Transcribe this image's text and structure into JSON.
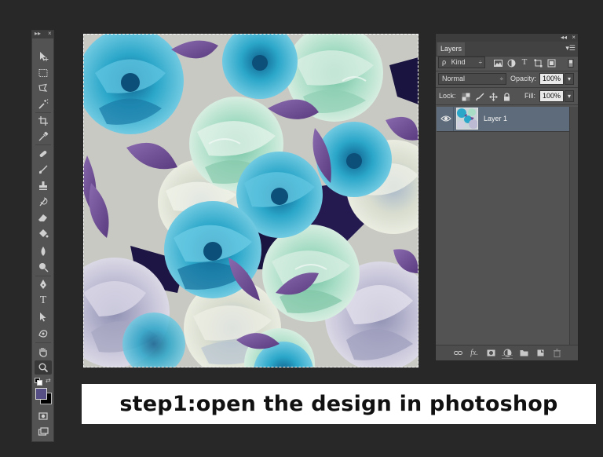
{
  "caption": "step1:open the design in photoshop",
  "tools_panel": {
    "header_glyphs": {
      "collapse": "▸▸",
      "close": "×"
    },
    "tools": [
      "move-tool-icon",
      "rectangular-marquee-icon",
      "lasso-icon",
      "magic-wand-icon",
      "crop-icon",
      "eyedropper-icon",
      "spot-healing-brush-icon",
      "brush-icon",
      "clone-stamp-icon",
      "history-brush-icon",
      "eraser-icon",
      "paint-bucket-icon",
      "blur-icon",
      "dodge-icon",
      "pen-icon",
      "type-icon",
      "path-selection-icon",
      "3d-object-icon",
      "hand-icon",
      "zoom-icon"
    ],
    "text": {
      "type_tool_glyph": "T"
    },
    "colors": {
      "foreground": "#554f86",
      "background": "#000000"
    }
  },
  "canvas": {
    "image": "floral-pattern",
    "palette": {
      "turquoise": "#2aa6c9",
      "deep_blue": "#1b6f9c",
      "mint": "#9ed8c2",
      "cream": "#dfe2cf",
      "lavender": "#b9b8cf",
      "purple_leaf": "#6e4a91",
      "navy_shadow": "#1a1440"
    }
  },
  "layers_panel": {
    "title": "Layers",
    "header_glyphs": {
      "collapse": "◂◂",
      "close": "×",
      "menu": "▾☰"
    },
    "filter": {
      "search_glyph": "ρ",
      "kind_label": "Kind",
      "arrow": "÷"
    },
    "filter_icons": [
      "image-filter-icon",
      "adjustment-filter-icon",
      "type-filter-icon",
      "shape-filter-icon",
      "smart-object-filter-icon"
    ],
    "filter_text": {
      "type_glyph": "T"
    },
    "blend_mode": "Normal",
    "blend_arrow": "÷",
    "opacity_label": "Opacity:",
    "opacity_value": "100%",
    "lock_label": "Lock:",
    "fill_label": "Fill:",
    "fill_value": "100%",
    "stepper_arrow": "▾",
    "layers": [
      {
        "name": "Layer 1",
        "visible": true
      }
    ],
    "bottom_icons": [
      "link-layers-icon",
      "fx-icon",
      "add-mask-icon",
      "adjustment-layer-icon",
      "new-group-icon",
      "new-layer-icon",
      "trash-icon"
    ],
    "bottom_text": {
      "fx_glyph": "fx."
    }
  }
}
